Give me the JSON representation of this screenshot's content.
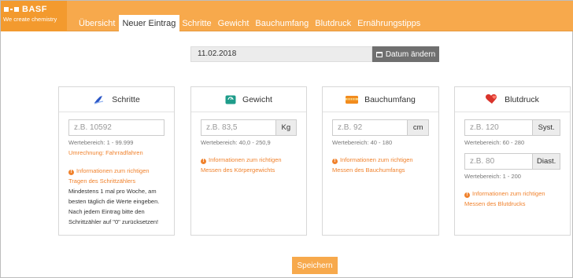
{
  "brand": {
    "name": "BASF",
    "tagline": "We create chemistry"
  },
  "nav": [
    {
      "label": "Übersicht",
      "active": false
    },
    {
      "label": "Neuer Eintrag",
      "active": true
    },
    {
      "label": "Schritte",
      "active": false
    },
    {
      "label": "Gewicht",
      "active": false
    },
    {
      "label": "Bauchumfang",
      "active": false
    },
    {
      "label": "Blutdruck",
      "active": false
    },
    {
      "label": "Ernährungstipps",
      "active": false
    }
  ],
  "date": {
    "value": "11.02.2018",
    "button_label": "Datum ändern"
  },
  "cards": {
    "steps": {
      "title": "Schritte",
      "placeholder": "z.B. 10592",
      "range": "Wertebereich: 1 - 99.999",
      "conversion_link": "Umrechnung: Fahrradfahren",
      "info_line1": "Informationen zum richtigen",
      "info_line2": "Tragen des Schrittzählers",
      "note_lines": [
        "Mindestens 1 mal pro Woche, am",
        "besten täglich die Werte eingeben.",
        "Nach jedem Eintrag bitte den",
        "Schrittzähler auf \"0\" zurücksetzen!"
      ]
    },
    "weight": {
      "title": "Gewicht",
      "placeholder": "z.B. 83,5",
      "unit": "Kg",
      "range": "Wertebereich: 40,0 - 250,9",
      "info_line1": "Informationen zum richtigen",
      "info_line2": "Messen des Körpergewichts"
    },
    "waist": {
      "title": "Bauchumfang",
      "placeholder": "z.B. 92",
      "unit": "cm",
      "range": "Wertebereich: 40 - 180",
      "info_line1": "Informationen zum richtigen",
      "info_line2": "Messen des Bauchumfangs"
    },
    "bp": {
      "title": "Blutdruck",
      "systolic_placeholder": "z.B. 120",
      "systolic_unit": "Syst.",
      "systolic_range": "Wertebereich: 60 - 280",
      "diastolic_placeholder": "z.B. 80",
      "diastolic_unit": "Diast.",
      "diastolic_range": "Wertebereich: 1 - 200",
      "info_line1": "Informationen zum richtigen",
      "info_line2": "Messen des Blutdrucks"
    }
  },
  "save_label": "Speichern",
  "colors": {
    "accent": "#f7a94c",
    "brand": "#f39a2e",
    "link": "#f0822d",
    "date_button": "#6f6f6f"
  }
}
